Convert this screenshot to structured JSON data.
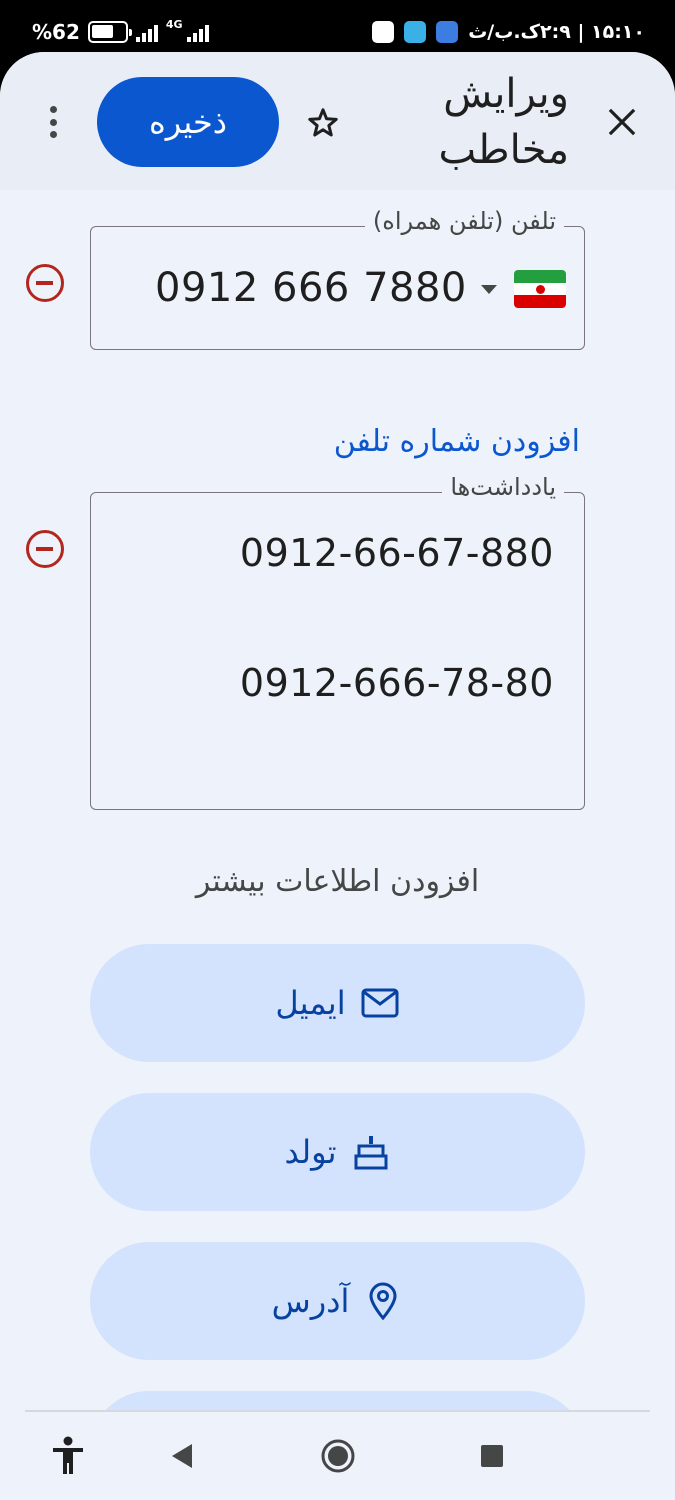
{
  "status_bar": {
    "battery_text": "%62",
    "network": "4G",
    "time_text": "۱۵:۱۰ | ۲:۹ک.ب/ث"
  },
  "topbar": {
    "title": "ویرایش مخاطب",
    "save_label": "ذخیره",
    "close_icon": "close-icon",
    "star_icon": "star-outline-icon",
    "more_icon": "more-vert-icon"
  },
  "phone_field": {
    "label": "تلفن (تلفن همراه)",
    "value": "0912 666 7880",
    "country_flag": "iran-flag-icon"
  },
  "add_phone_label": "افزودن شماره تلفن",
  "notes_field": {
    "label": "یادداشت‌ها",
    "lines": [
      "0912-66-67-880",
      "0912-666-78-80"
    ]
  },
  "more_info_heading": "افزودن اطلاعات بیشتر",
  "more_info_buttons": [
    {
      "label": "ایمیل",
      "icon": "mail-icon"
    },
    {
      "label": "تولد",
      "icon": "cake-icon"
    },
    {
      "label": "آدرس",
      "icon": "location-pin-icon"
    }
  ],
  "colors": {
    "accent": "#0b57d0",
    "chip_bg": "#d3e3fd",
    "remove_red": "#b3261e",
    "surface": "#eef2fa"
  }
}
